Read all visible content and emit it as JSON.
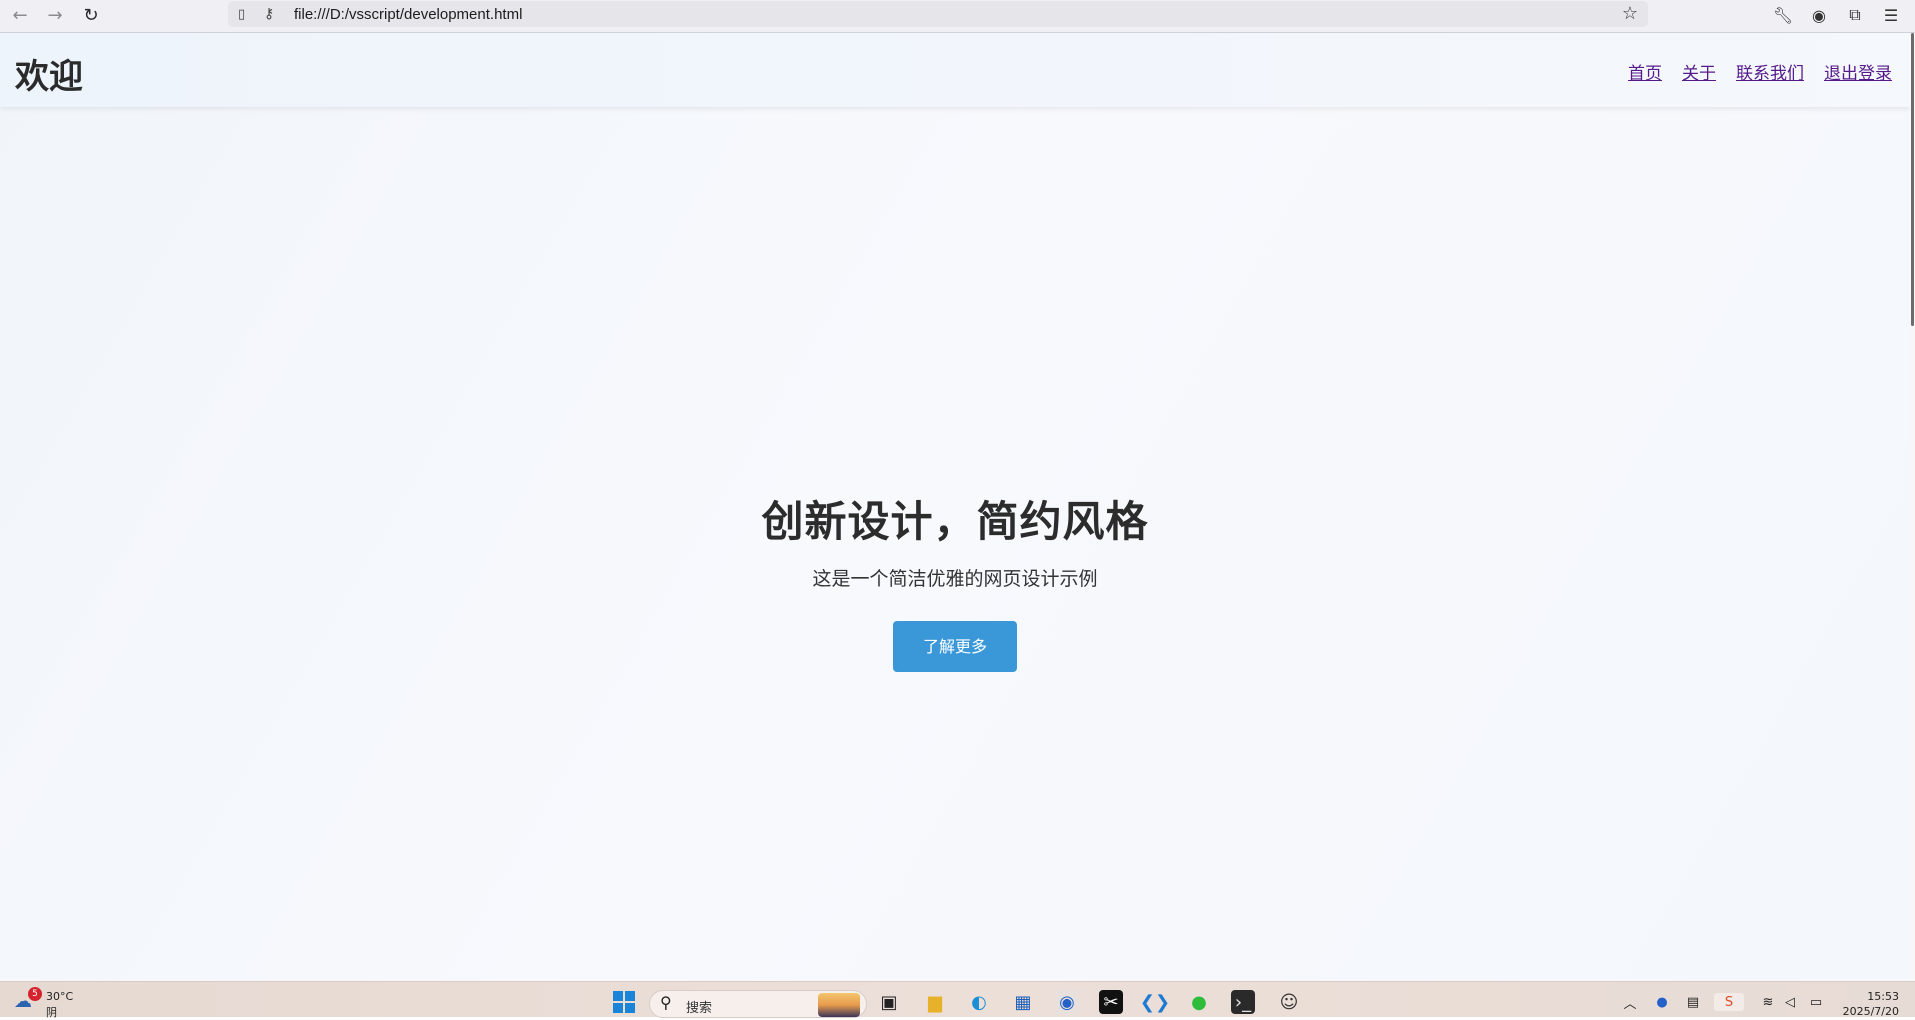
{
  "browser": {
    "url": "file:///D:/vsscript/development.html"
  },
  "site": {
    "logo": "欢迎",
    "nav": [
      {
        "label": "首页"
      },
      {
        "label": "关于"
      },
      {
        "label": "联系我们"
      },
      {
        "label": "退出登录"
      }
    ]
  },
  "hero": {
    "title": "创新设计，简约风格",
    "subtitle": "这是一个简洁优雅的网页设计示例",
    "button_label": "了解更多"
  },
  "taskbar": {
    "weather": {
      "badge": "5",
      "temperature": "30°C",
      "condition": "阴"
    },
    "search_label": "搜索",
    "clock": {
      "time": "15:53",
      "date": "2025/7/20"
    }
  },
  "colors": {
    "accent_button": "#3a98d8",
    "link_visited": "#551a8b"
  }
}
